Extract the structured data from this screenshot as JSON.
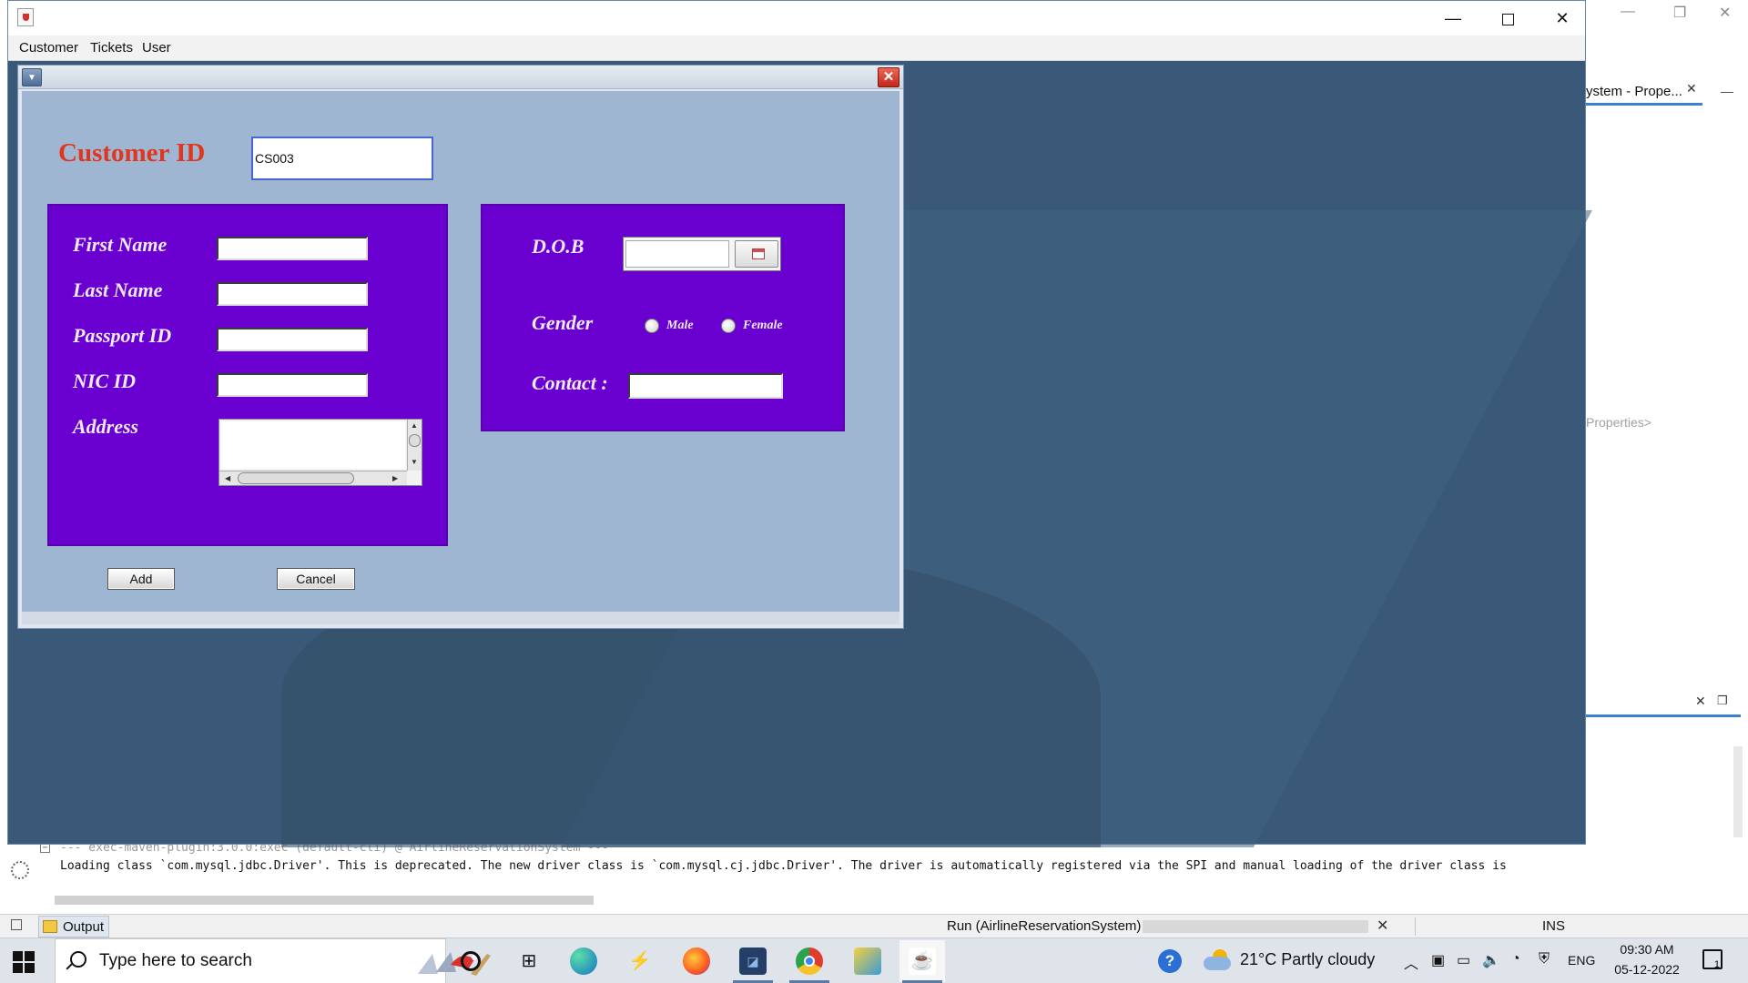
{
  "ide": {
    "properties_tab": "ystem - Prope...",
    "properties_placeholder": "Properties>",
    "output": {
      "line1": "--- exec-maven-plugin:3.0.0:exec (default-cli) @ AirlineReservationSystem ---",
      "line2": "Loading class `com.mysql.jdbc.Driver'. This is deprecated. The new driver class is `com.mysql.cj.jdbc.Driver'. The driver is automatically registered via the SPI and manual loading of the driver class is"
    },
    "status": {
      "output_tab": "Output",
      "run_label": "Run (AirlineReservationSystem)",
      "ins": "INS"
    }
  },
  "app": {
    "menu": [
      "Customer",
      "Tickets",
      "User"
    ],
    "form": {
      "customer_id_label": "Customer ID",
      "customer_id_value": "CS003",
      "first_name_label": "First Name",
      "last_name_label": "Last Name",
      "passport_label": "Passport ID",
      "nic_label": "NIC ID",
      "address_label": "Address",
      "dob_label": "D.O.B",
      "gender_label": "Gender",
      "gender_options": [
        "Male",
        "Female"
      ],
      "contact_label": "Contact :",
      "add_button": "Add",
      "cancel_button": "Cancel"
    }
  },
  "taskbar": {
    "search_placeholder": "Type here to search",
    "weather": "21°C  Partly cloudy",
    "language": "ENG",
    "time": "09:30 AM",
    "date": "05-12-2022",
    "notifications_count": "1"
  },
  "colors": {
    "panel_purple": "#6a00d0",
    "form_bg": "#9fb6d3",
    "customer_id_red": "#e0361e",
    "desktop_blue": "#3a5877"
  }
}
